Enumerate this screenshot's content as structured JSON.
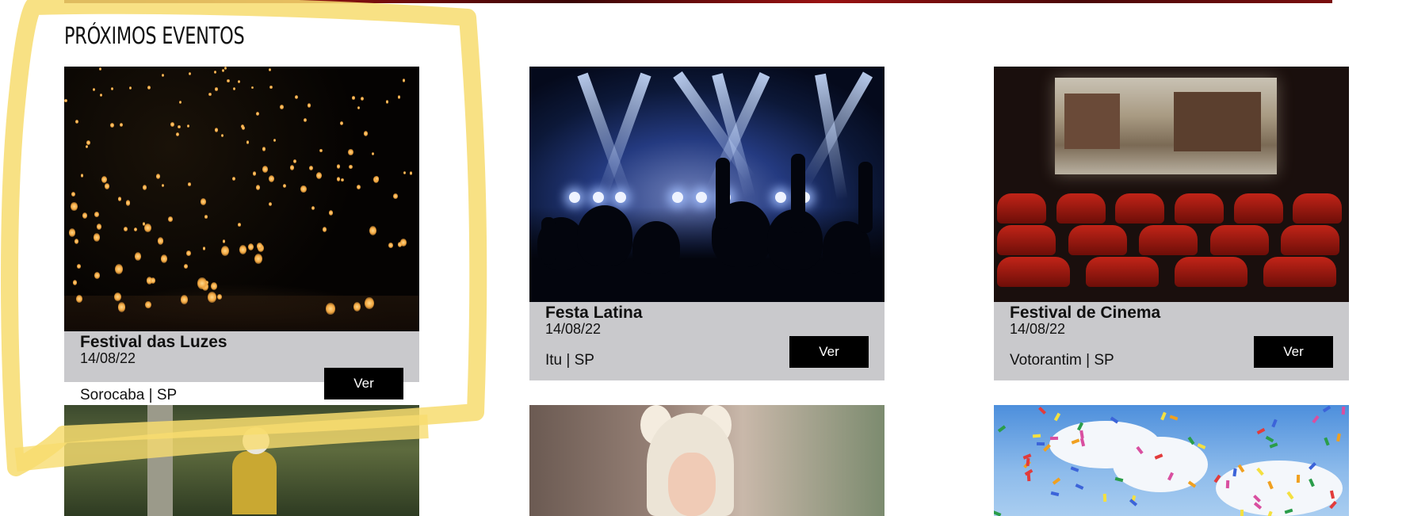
{
  "section": {
    "title": "PRÓXIMOS EVENTOS"
  },
  "events": [
    {
      "name": "Festival das Luzes",
      "date": "14/08/22",
      "location": "Sorocaba | SP",
      "button": "Ver"
    },
    {
      "name": "Festa Latina",
      "date": "14/08/22",
      "location": "Itu | SP",
      "button": "Ver"
    },
    {
      "name": "Festival de Cinema",
      "date": "14/08/22",
      "location": "Votorantim | SP",
      "button": "Ver"
    }
  ],
  "colors": {
    "info_bg": "#c9c9cc",
    "button_bg": "#000000",
    "highlight": "#f7dc6f"
  }
}
